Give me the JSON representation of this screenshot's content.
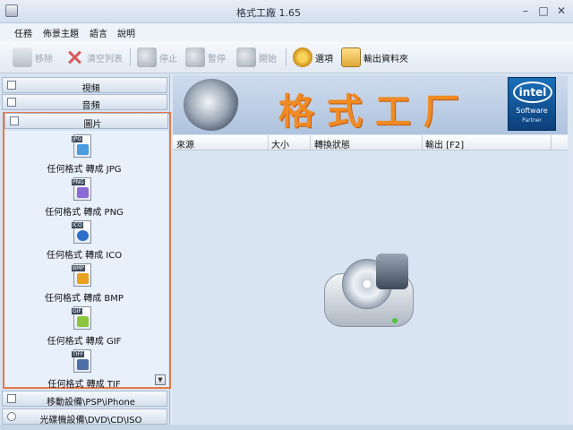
{
  "window": {
    "title": "格式工廠 1.65",
    "min": "–",
    "max": "□",
    "close": "✕"
  },
  "menu": [
    "任務",
    "佈景主題",
    "語言",
    "說明"
  ],
  "toolbar": {
    "remove": "移除",
    "clear": "清空列表",
    "stop": "停止",
    "pause": "暫停",
    "start": "開始",
    "options": "選項",
    "output_folder": "輸出資料夾"
  },
  "categories": {
    "video": "視頻",
    "audio": "音頻",
    "picture": "圖片",
    "mobile": "移動設備\\PSP\\iPhone",
    "disc": "光碟機設備\\DVD\\CD\\ISO"
  },
  "picture_items": [
    {
      "tag": "JPG",
      "label": "任何格式 轉成 JPG",
      "color": "#4a9be0"
    },
    {
      "tag": "PNG",
      "label": "任何格式 轉成 PNG",
      "color": "#8c6ad6"
    },
    {
      "tag": "ICO",
      "label": "任何格式 轉成 ICO",
      "color": "#2c6fc9"
    },
    {
      "tag": "BMP",
      "label": "任何格式 轉成 BMP",
      "color": "#e9a220"
    },
    {
      "tag": "GIF",
      "label": "任何格式 轉成 GIF",
      "color": "#8cc63f"
    },
    {
      "tag": "TIFF",
      "label": "任何格式 轉成 TIF",
      "color": "#4d6fa8"
    }
  ],
  "banner": {
    "title": "格式工厂",
    "intel_logo": "intel",
    "intel_software": "Software",
    "intel_partner": "Partner"
  },
  "table": {
    "columns": [
      "來源",
      "大小",
      "轉換狀態",
      "輸出 [F2]"
    ]
  },
  "colors": {
    "highlight": "#e8784a",
    "banner_title": "#f08a24",
    "intel": "#1a6fb8"
  }
}
